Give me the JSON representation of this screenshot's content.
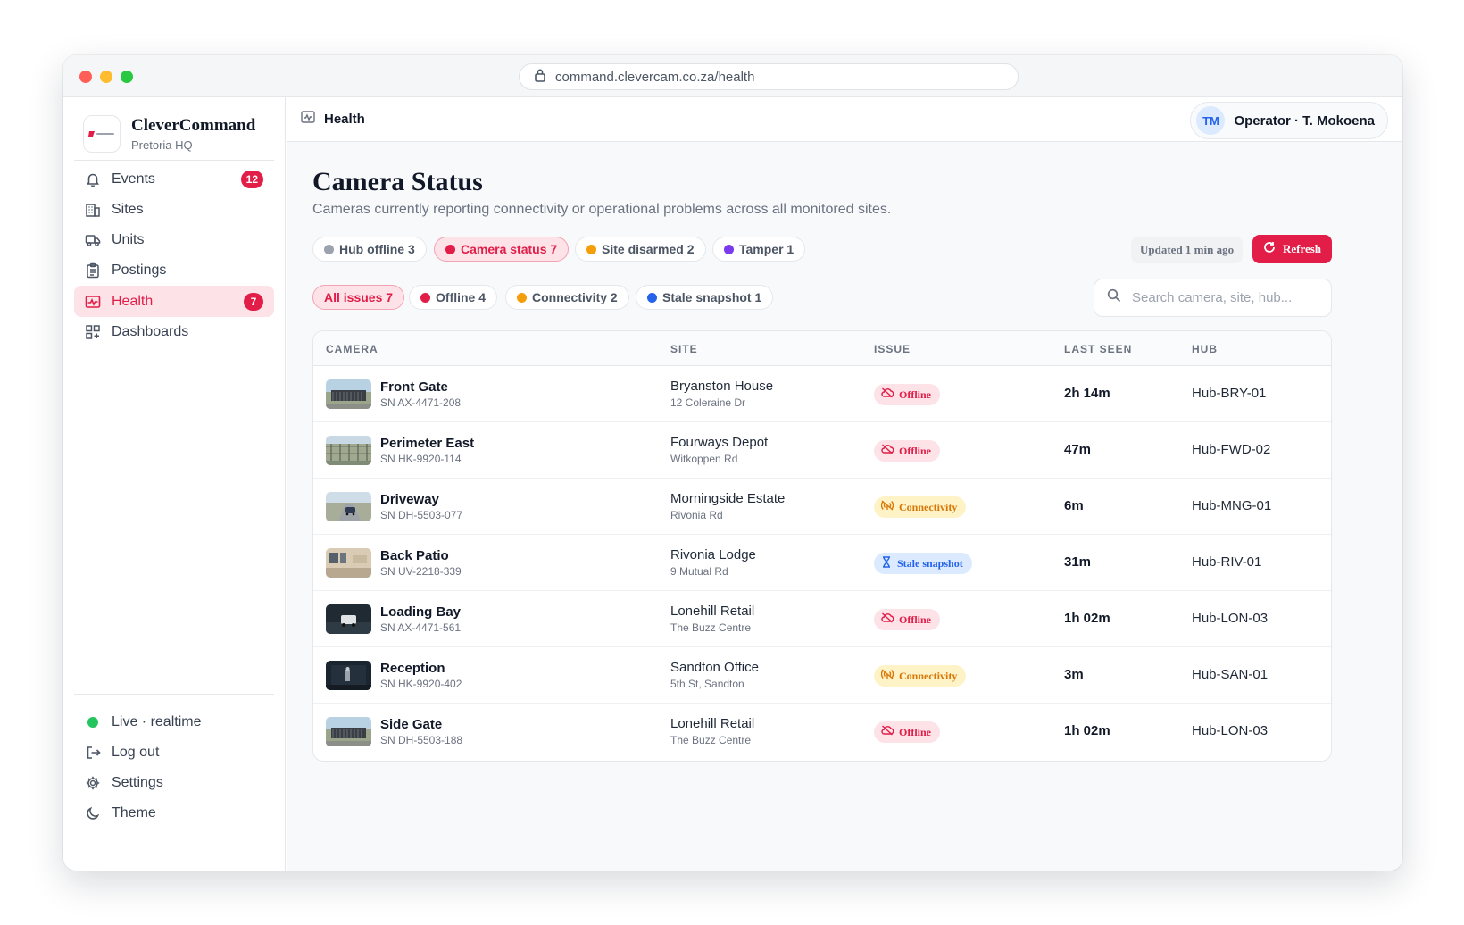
{
  "browser": {
    "url": "command.clevercam.co.za/health"
  },
  "brand": {
    "name": "CleverCommand",
    "location": "Pretoria HQ"
  },
  "nav": [
    {
      "label": "Events",
      "badge": "12",
      "icon": "bell-icon"
    },
    {
      "label": "Sites",
      "badge": "",
      "icon": "building-icon"
    },
    {
      "label": "Units",
      "badge": "",
      "icon": "truck-icon"
    },
    {
      "label": "Postings",
      "badge": "",
      "icon": "clipboard-icon"
    },
    {
      "label": "Health",
      "badge": "7",
      "icon": "pulse-icon",
      "active": true
    },
    {
      "label": "Dashboards",
      "badge": "",
      "icon": "grid-icon"
    }
  ],
  "sidebar_bottom": {
    "status": "Live · realtime",
    "logout": "Log out",
    "settings": "Settings",
    "theme": "Theme"
  },
  "topbar": {
    "title": "Health",
    "operator_initials": "TM",
    "operator": "Operator · T. Mokoena"
  },
  "page": {
    "title": "Camera Status",
    "subtitle": "Cameras currently reporting connectivity or operational problems across all monitored sites."
  },
  "category_chips": [
    {
      "label": "Hub offline 3",
      "color": "#9ca3af",
      "active": false
    },
    {
      "label": "Camera status 7",
      "color": "#e11d48",
      "active": true
    },
    {
      "label": "Site disarmed 2",
      "color": "#f59e0b",
      "active": false
    },
    {
      "label": "Tamper 1",
      "color": "#7c3aed",
      "active": false
    }
  ],
  "filter_chips": [
    {
      "label": "All issues 7",
      "color": "",
      "active": true
    },
    {
      "label": "Offline 4",
      "color": "#e11d48",
      "active": false
    },
    {
      "label": "Connectivity 2",
      "color": "#f59e0b",
      "active": false
    },
    {
      "label": "Stale snapshot 1",
      "color": "#2563eb",
      "active": false
    }
  ],
  "updated": "Updated 1 min ago",
  "refresh_label": "Refresh",
  "search": {
    "placeholder": "Search camera, site, hub..."
  },
  "table": {
    "headers": [
      "CAMERA",
      "SITE",
      "ISSUE",
      "LAST SEEN",
      "HUB"
    ],
    "rows": [
      {
        "camera": "Front Gate",
        "sn": "SN AX-4471-208",
        "site": "Bryanston House",
        "site_sub": "12 Coleraine Dr",
        "issue": "Offline",
        "issue_type": "offline",
        "last_seen": "2h 14m",
        "hub": "Hub-BRY-01",
        "thumb": "gate"
      },
      {
        "camera": "Perimeter East",
        "sn": "SN HK-9920-114",
        "site": "Fourways Depot",
        "site_sub": "Witkoppen Rd",
        "issue": "Offline",
        "issue_type": "offline",
        "last_seen": "47m",
        "hub": "Hub-FWD-02",
        "thumb": "fence"
      },
      {
        "camera": "Driveway",
        "sn": "SN DH-5503-077",
        "site": "Morningside Estate",
        "site_sub": "Rivonia Rd",
        "issue": "Connectivity",
        "issue_type": "connectivity",
        "last_seen": "6m",
        "hub": "Hub-MNG-01",
        "thumb": "driveway"
      },
      {
        "camera": "Back Patio",
        "sn": "SN UV-2218-339",
        "site": "Rivonia Lodge",
        "site_sub": "9 Mutual Rd",
        "issue": "Stale snapshot",
        "issue_type": "stale",
        "last_seen": "31m",
        "hub": "Hub-RIV-01",
        "thumb": "patio"
      },
      {
        "camera": "Loading Bay",
        "sn": "SN AX-4471-561",
        "site": "Lonehill Retail",
        "site_sub": "The Buzz Centre",
        "issue": "Offline",
        "issue_type": "offline",
        "last_seen": "1h 02m",
        "hub": "Hub-LON-03",
        "thumb": "bay"
      },
      {
        "camera": "Reception",
        "sn": "SN HK-9920-402",
        "site": "Sandton Office",
        "site_sub": "5th St, Sandton",
        "issue": "Connectivity",
        "issue_type": "connectivity",
        "last_seen": "3m",
        "hub": "Hub-SAN-01",
        "thumb": "reception"
      },
      {
        "camera": "Side Gate",
        "sn": "SN DH-5503-188",
        "site": "Lonehill Retail",
        "site_sub": "The Buzz Centre",
        "issue": "Offline",
        "issue_type": "offline",
        "last_seen": "1h 02m",
        "hub": "Hub-LON-03",
        "thumb": "gate"
      }
    ]
  }
}
